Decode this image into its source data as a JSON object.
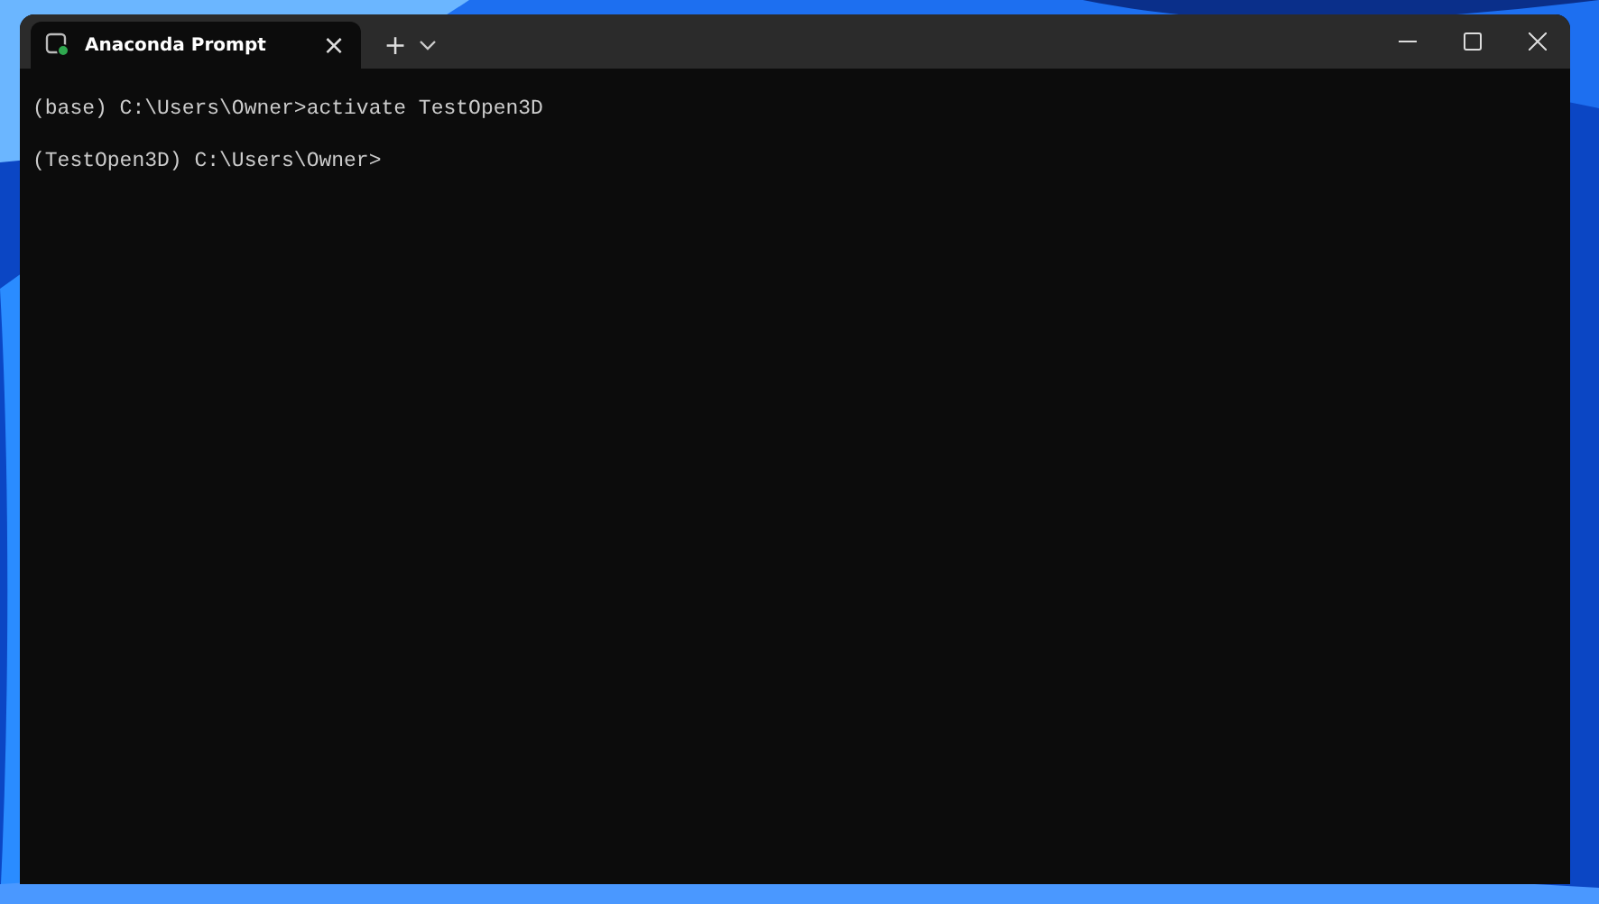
{
  "window": {
    "tab": {
      "title": "Anaconda Prompt",
      "selected": true,
      "close": "×"
    },
    "new_tab": "+"
  },
  "terminal": {
    "lines": [
      "(base) C:\\Users\\Owner>activate TestOpen3D",
      "(TestOpen3D) C:\\Users\\Owner>"
    ]
  }
}
